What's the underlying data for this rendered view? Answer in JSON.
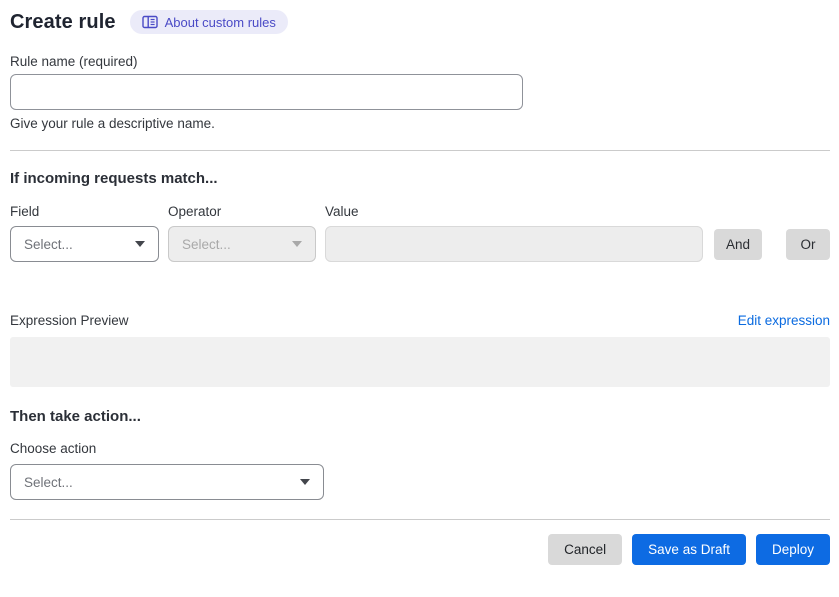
{
  "header": {
    "title": "Create rule",
    "badge": {
      "label": "About custom rules",
      "icon": "book-icon"
    }
  },
  "rule_name": {
    "label": "Rule name (required)",
    "value": "",
    "helper": "Give your rule a descriptive name."
  },
  "match_section": {
    "heading": "If incoming requests match...",
    "field": {
      "label": "Field",
      "selected": "Select...",
      "enabled": true
    },
    "operator": {
      "label": "Operator",
      "selected": "Select...",
      "enabled": false
    },
    "value": {
      "label": "Value",
      "value": "",
      "enabled": false
    },
    "and_label": "And",
    "or_label": "Or"
  },
  "expression": {
    "label": "Expression Preview",
    "edit_link": "Edit expression",
    "content": ""
  },
  "action_section": {
    "heading": "Then take action...",
    "choose_label": "Choose action",
    "select_value": "Select..."
  },
  "footer": {
    "cancel_label": "Cancel",
    "save_draft_label": "Save as Draft",
    "deploy_label": "Deploy"
  },
  "colors": {
    "primary_blue": "#0d6be3",
    "link_blue": "#0b6be0",
    "badge_bg": "#ebebf9",
    "badge_text": "#4a4ac6",
    "neutral_button": "#d9d9d9",
    "disabled_bg": "#ededed",
    "preview_bg": "#f1f1f1"
  }
}
